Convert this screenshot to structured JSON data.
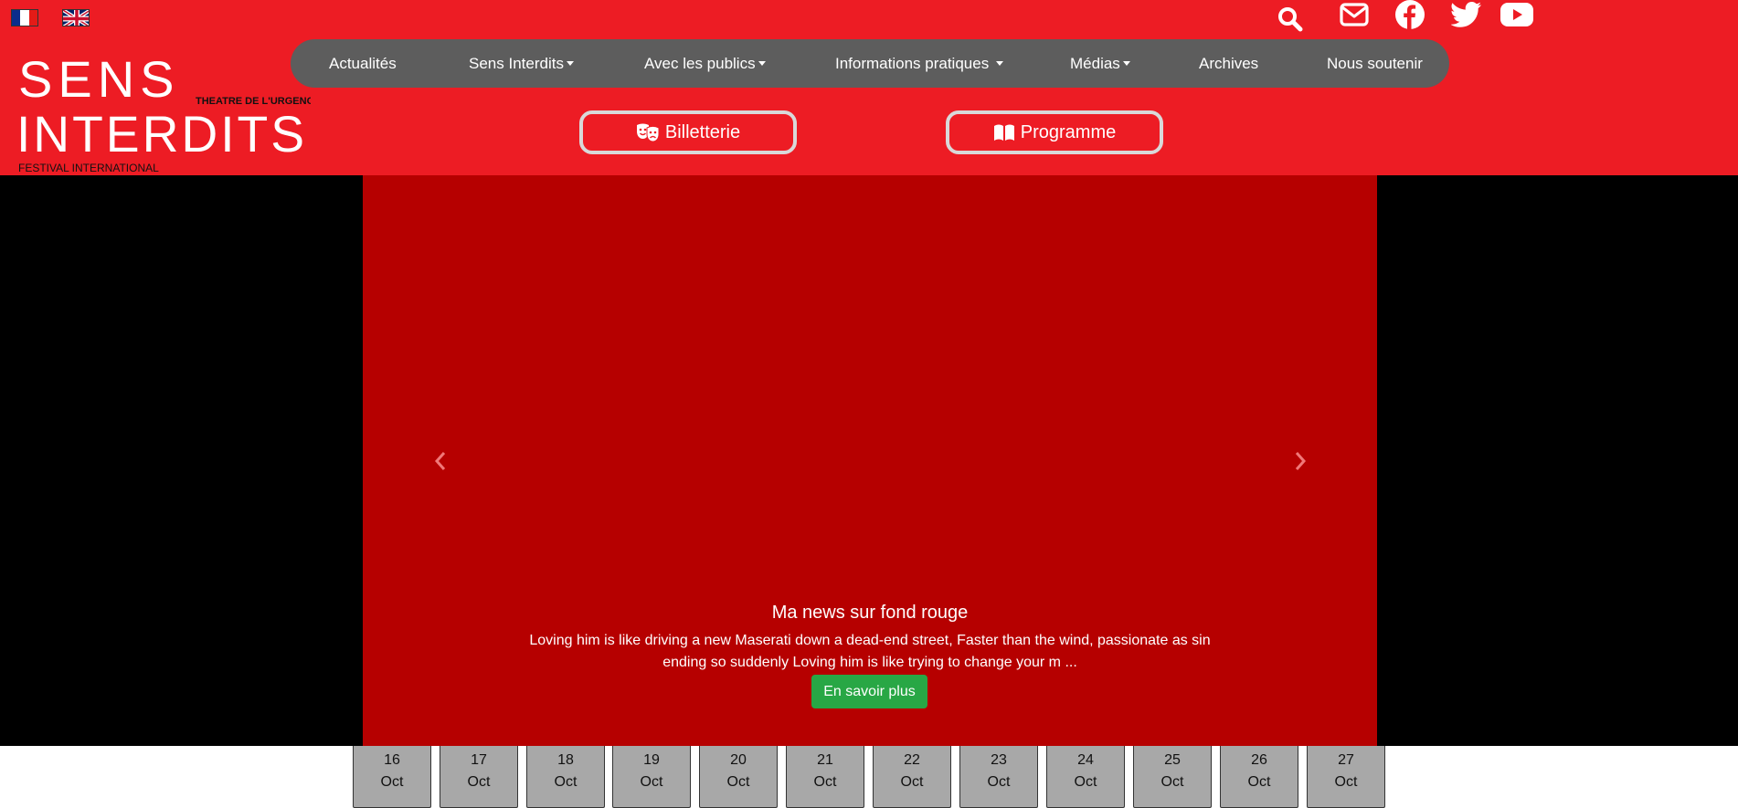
{
  "languages": [
    {
      "code": "fr",
      "flag": "flag-fr-icon"
    },
    {
      "code": "en",
      "flag": "flag-uk-icon"
    }
  ],
  "logo": {
    "line1": "SENS",
    "line2": "INTERDITS",
    "tagline": "THEATRE DE L'URGENCE",
    "subline": "FESTIVAL INTERNATIONAL"
  },
  "header_icons": [
    "search-icon",
    "envelope-icon",
    "facebook-icon",
    "twitter-icon",
    "youtube-icon"
  ],
  "nav": {
    "items": [
      {
        "label": "Actualités",
        "dropdown": false
      },
      {
        "label": "Sens Interdits",
        "dropdown": true
      },
      {
        "label": "Avec les publics",
        "dropdown": true
      },
      {
        "label": "Informations pratiques",
        "dropdown": true
      },
      {
        "label": "Médias",
        "dropdown": true
      },
      {
        "label": "Archives",
        "dropdown": false
      },
      {
        "label": "Nous soutenir",
        "dropdown": false
      }
    ]
  },
  "cta": {
    "tickets": {
      "label": "Billetterie",
      "icon": "theater-masks-icon"
    },
    "program": {
      "label": "Programme",
      "icon": "book-open-icon"
    }
  },
  "carousel": {
    "title": "Ma news sur fond rouge",
    "text": "Loving him is like driving a new Maserati down a dead-end street, Faster than the wind, passionate as sin ending so suddenly Loving him is like trying to change your m ...",
    "button": "En savoir plus",
    "prev_icon": "chevron-left-icon",
    "next_icon": "chevron-right-icon"
  },
  "dates": [
    {
      "day": "16",
      "month": "Oct"
    },
    {
      "day": "17",
      "month": "Oct"
    },
    {
      "day": "18",
      "month": "Oct"
    },
    {
      "day": "19",
      "month": "Oct"
    },
    {
      "day": "20",
      "month": "Oct"
    },
    {
      "day": "21",
      "month": "Oct"
    },
    {
      "day": "22",
      "month": "Oct"
    },
    {
      "day": "23",
      "month": "Oct"
    },
    {
      "day": "24",
      "month": "Oct"
    },
    {
      "day": "25",
      "month": "Oct"
    },
    {
      "day": "26",
      "month": "Oct"
    },
    {
      "day": "27",
      "month": "Oct"
    }
  ],
  "colors": {
    "header_red": "#ed1c24",
    "slide_red": "#b60000",
    "nav_grey": "#5d5d5d",
    "button_green": "#28a745",
    "date_grey": "#a8a8a8"
  }
}
